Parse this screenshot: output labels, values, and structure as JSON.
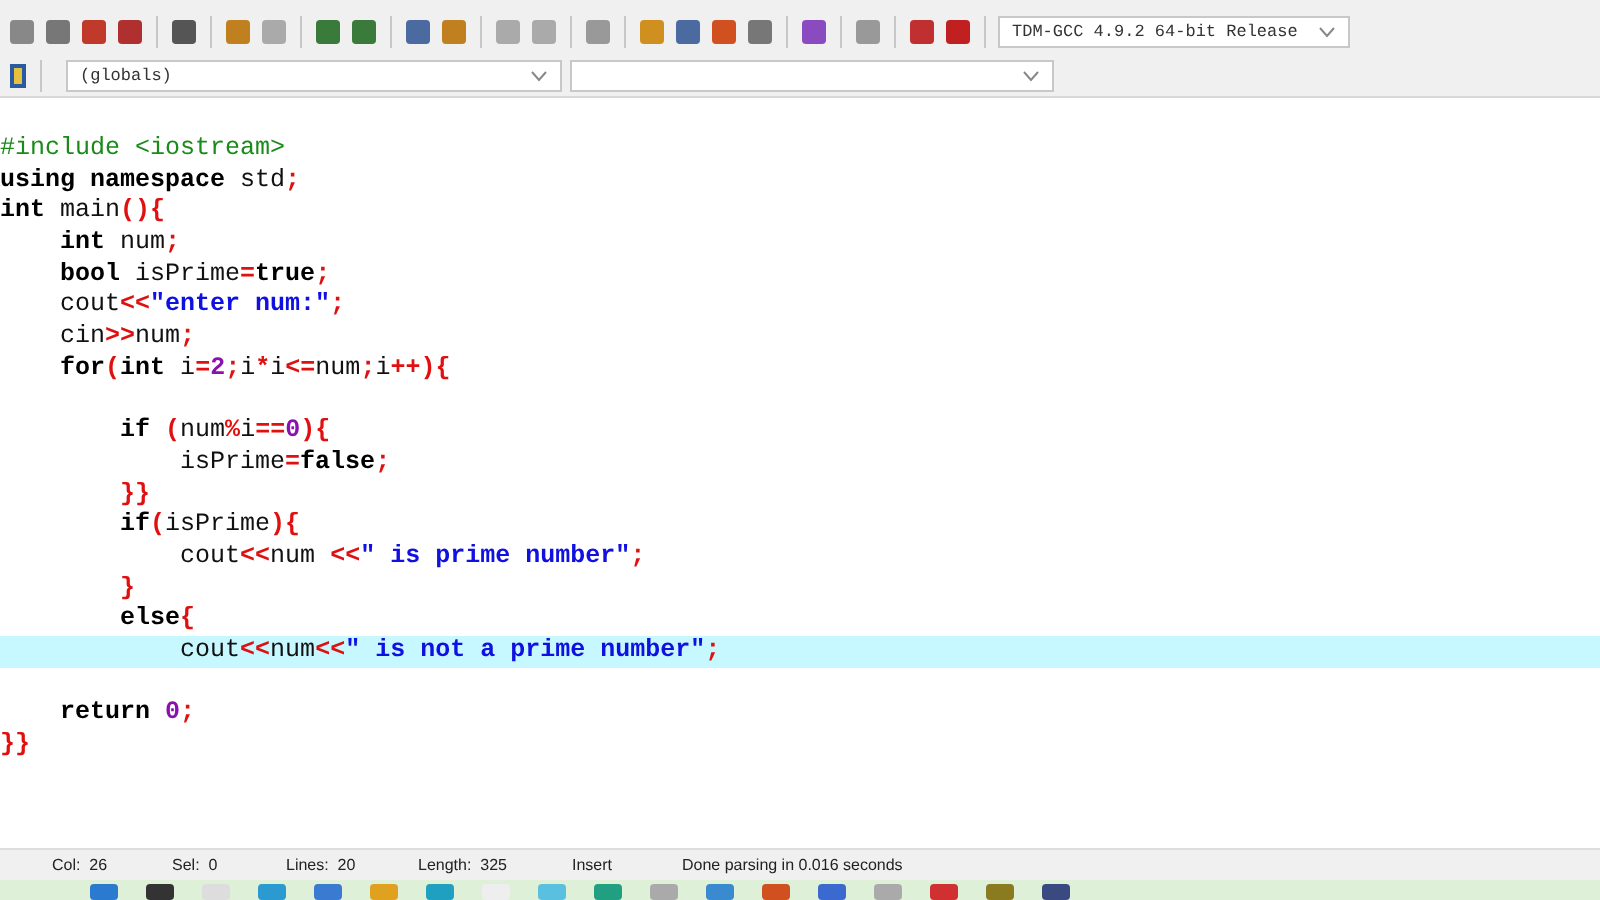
{
  "toolbar": {
    "compiler_select": {
      "value": "TDM-GCC 4.9.2 64-bit Release"
    }
  },
  "class_bar": {
    "scope_select": {
      "value": "(globals)"
    }
  },
  "editor": {
    "lines": [
      {
        "current": false,
        "tokens": [
          {
            "kind": "pre",
            "text": "#include <iostream>"
          }
        ]
      },
      {
        "current": false,
        "tokens": [
          {
            "kind": "kw",
            "text": "using namespace"
          },
          {
            "kind": "plain",
            "text": " std"
          },
          {
            "kind": "sym",
            "text": ";"
          }
        ]
      },
      {
        "current": false,
        "tokens": [
          {
            "kind": "kw",
            "text": "int"
          },
          {
            "kind": "plain",
            "text": " main"
          },
          {
            "kind": "sym",
            "text": "(){"
          }
        ]
      },
      {
        "current": false,
        "tokens": [
          {
            "kind": "kw",
            "text": "    int"
          },
          {
            "kind": "plain",
            "text": " num"
          },
          {
            "kind": "sym",
            "text": ";"
          }
        ]
      },
      {
        "current": false,
        "tokens": [
          {
            "kind": "kw",
            "text": "    bool"
          },
          {
            "kind": "plain",
            "text": " isPrime"
          },
          {
            "kind": "sym",
            "text": "="
          },
          {
            "kind": "kw",
            "text": "true"
          },
          {
            "kind": "sym",
            "text": ";"
          }
        ]
      },
      {
        "current": false,
        "tokens": [
          {
            "kind": "plain",
            "text": "    cout"
          },
          {
            "kind": "sym",
            "text": "<<"
          },
          {
            "kind": "str",
            "text": "\"enter num:\""
          },
          {
            "kind": "sym",
            "text": ";"
          }
        ]
      },
      {
        "current": false,
        "tokens": [
          {
            "kind": "plain",
            "text": "    cin"
          },
          {
            "kind": "sym",
            "text": ">>"
          },
          {
            "kind": "plain",
            "text": "num"
          },
          {
            "kind": "sym",
            "text": ";"
          }
        ]
      },
      {
        "current": false,
        "tokens": [
          {
            "kind": "kw",
            "text": "    for"
          },
          {
            "kind": "sym",
            "text": "("
          },
          {
            "kind": "kw",
            "text": "int"
          },
          {
            "kind": "plain",
            "text": " i"
          },
          {
            "kind": "sym",
            "text": "="
          },
          {
            "kind": "num",
            "text": "2"
          },
          {
            "kind": "sym",
            "text": ";"
          },
          {
            "kind": "plain",
            "text": "i"
          },
          {
            "kind": "sym",
            "text": "*"
          },
          {
            "kind": "plain",
            "text": "i"
          },
          {
            "kind": "sym",
            "text": "<="
          },
          {
            "kind": "plain",
            "text": "num"
          },
          {
            "kind": "sym",
            "text": ";"
          },
          {
            "kind": "plain",
            "text": "i"
          },
          {
            "kind": "sym",
            "text": "++){"
          }
        ]
      },
      {
        "current": false
      },
      {
        "current": false,
        "tokens": [
          {
            "kind": "kw",
            "text": "        if"
          },
          {
            "kind": "sym",
            "text": " ("
          },
          {
            "kind": "plain",
            "text": "num"
          },
          {
            "kind": "sym",
            "text": "%"
          },
          {
            "kind": "plain",
            "text": "i"
          },
          {
            "kind": "sym",
            "text": "=="
          },
          {
            "kind": "num",
            "text": "0"
          },
          {
            "kind": "sym",
            "text": "){"
          }
        ]
      },
      {
        "current": false,
        "tokens": [
          {
            "kind": "plain",
            "text": "            isPrime"
          },
          {
            "kind": "sym",
            "text": "="
          },
          {
            "kind": "kw",
            "text": "false"
          },
          {
            "kind": "sym",
            "text": ";"
          }
        ]
      },
      {
        "current": false,
        "tokens": [
          {
            "kind": "sym",
            "text": "        }}"
          }
        ]
      },
      {
        "current": false,
        "tokens": [
          {
            "kind": "kw",
            "text": "        if"
          },
          {
            "kind": "sym",
            "text": "("
          },
          {
            "kind": "plain",
            "text": "isPrime"
          },
          {
            "kind": "sym",
            "text": "){"
          }
        ]
      },
      {
        "current": false,
        "tokens": [
          {
            "kind": "plain",
            "text": "            cout"
          },
          {
            "kind": "sym",
            "text": "<<"
          },
          {
            "kind": "plain",
            "text": "num "
          },
          {
            "kind": "sym",
            "text": "<<"
          },
          {
            "kind": "str",
            "text": "\" is prime number\""
          },
          {
            "kind": "sym",
            "text": ";"
          }
        ]
      },
      {
        "current": false,
        "tokens": [
          {
            "kind": "sym",
            "text": "        }"
          }
        ]
      },
      {
        "current": false,
        "tokens": [
          {
            "kind": "kw",
            "text": "        else"
          },
          {
            "kind": "sym",
            "text": "{"
          }
        ]
      },
      {
        "current": true,
        "tokens": [
          {
            "kind": "plain",
            "text": "            cout"
          },
          {
            "kind": "sym",
            "text": "<<"
          },
          {
            "kind": "plain",
            "text": "num"
          },
          {
            "kind": "sym",
            "text": "<<"
          },
          {
            "kind": "str",
            "text": "\" is not a prime number\""
          },
          {
            "kind": "sym",
            "text": ";"
          }
        ]
      },
      {
        "current": false
      },
      {
        "current": false,
        "tokens": [
          {
            "kind": "kw",
            "text": "    return"
          },
          {
            "kind": "num",
            "text": " 0"
          },
          {
            "kind": "sym",
            "text": ";"
          }
        ]
      },
      {
        "current": false,
        "tokens": [
          {
            "kind": "sym",
            "text": "}}"
          }
        ]
      }
    ]
  },
  "status_bar": [
    {
      "label": "Col:",
      "value": "26"
    },
    {
      "label": "Sel:",
      "value": "0"
    },
    {
      "label": "Lines:",
      "value": "20"
    },
    {
      "label": "Length:",
      "value": "325"
    },
    {
      "label": "Insert"
    },
    {
      "label": "Done parsing in 0.016 seconds"
    }
  ]
}
